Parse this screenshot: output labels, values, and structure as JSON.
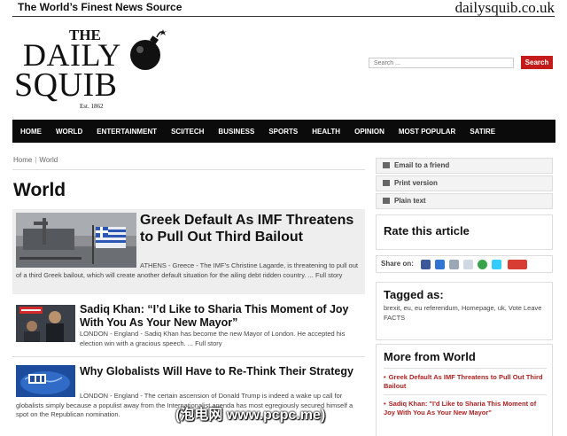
{
  "header": {
    "tagline": "The World’s Finest News Source",
    "domain": "dailysquib.co.uk"
  },
  "logo": {
    "the": "THE",
    "daily": "DAILY",
    "squib": "SQUIB",
    "est": "Est. 1862"
  },
  "search": {
    "placeholder": "Search ...",
    "button_label": "Search"
  },
  "nav": {
    "items": [
      "HOME",
      "WORLD",
      "ENTERTAINMENT",
      "SCI/TECH",
      "BUSINESS",
      "SPORTS",
      "HEALTH",
      "OPINION",
      "MOST POPULAR",
      "SATIRE"
    ]
  },
  "breadcrumb": {
    "home": "Home",
    "separator": "|",
    "current": "World"
  },
  "page_title": "World",
  "articles": [
    {
      "headline": "Greek Default As IMF Threatens to Pull Out Third Bailout",
      "excerpt": "ATHENS - Greece - The IMF’s Christine Lagarde, is threatening to pull out of a third Greek bailout, which will create another default situation for the ailing debt ridden country. ... Full story"
    },
    {
      "headline": "Sadiq Khan: “I’d Like to Sharia This Moment of Joy With You As Your New Mayor”",
      "excerpt": "LONDON - England - Sadiq Khan has become the new Mayor of London. He accepted his election win with a gracious speech. ... Full story"
    },
    {
      "headline": "Why Globalists Will Have to Re-Think Their Strategy",
      "excerpt": "LONDON - England - The certain ascension of Donald Trump is indeed a wake up call for globalists simply because a populist away from the Internationalist agenda has most egregiously secured himself a spot on the Republican nomination."
    }
  ],
  "sidebar": {
    "tools": [
      "Email to a friend",
      "Print version",
      "Plain text"
    ],
    "rate_title": "Rate this article",
    "share_label": "Share on:",
    "share_icons": [
      {
        "name": "facebook-icon",
        "color": "#3b5998"
      },
      {
        "name": "delicious-icon",
        "color": "#3274d1"
      },
      {
        "name": "digg-icon",
        "color": "#9aa7b5"
      },
      {
        "name": "reddit-icon",
        "color": "#cfd8e3"
      },
      {
        "name": "stumbleupon-icon",
        "color": "#3aa34a"
      },
      {
        "name": "twitter-icon",
        "color": "#33ccff"
      },
      {
        "name": "google-plus-icon",
        "color": "#d73d32"
      }
    ],
    "tagged_title": "Tagged as:",
    "tags": "brexit, eu, eu referendum, Homepage, uk, Vote Leave FACTS",
    "more_title": "More from World",
    "more_items": [
      "Greek Default As IMF Threatens to Pull Out Third Bailout",
      "Sadiq Khan: \"I'd Like to Sharia This Moment of Joy With You As Your New Mayor\""
    ]
  },
  "watermark": "(泡电网 www.pcpc.me)",
  "colors": {
    "accent_red": "#c41a1a",
    "nav_bg": "#0b0b0b",
    "featured_bg": "#eeeeee"
  }
}
